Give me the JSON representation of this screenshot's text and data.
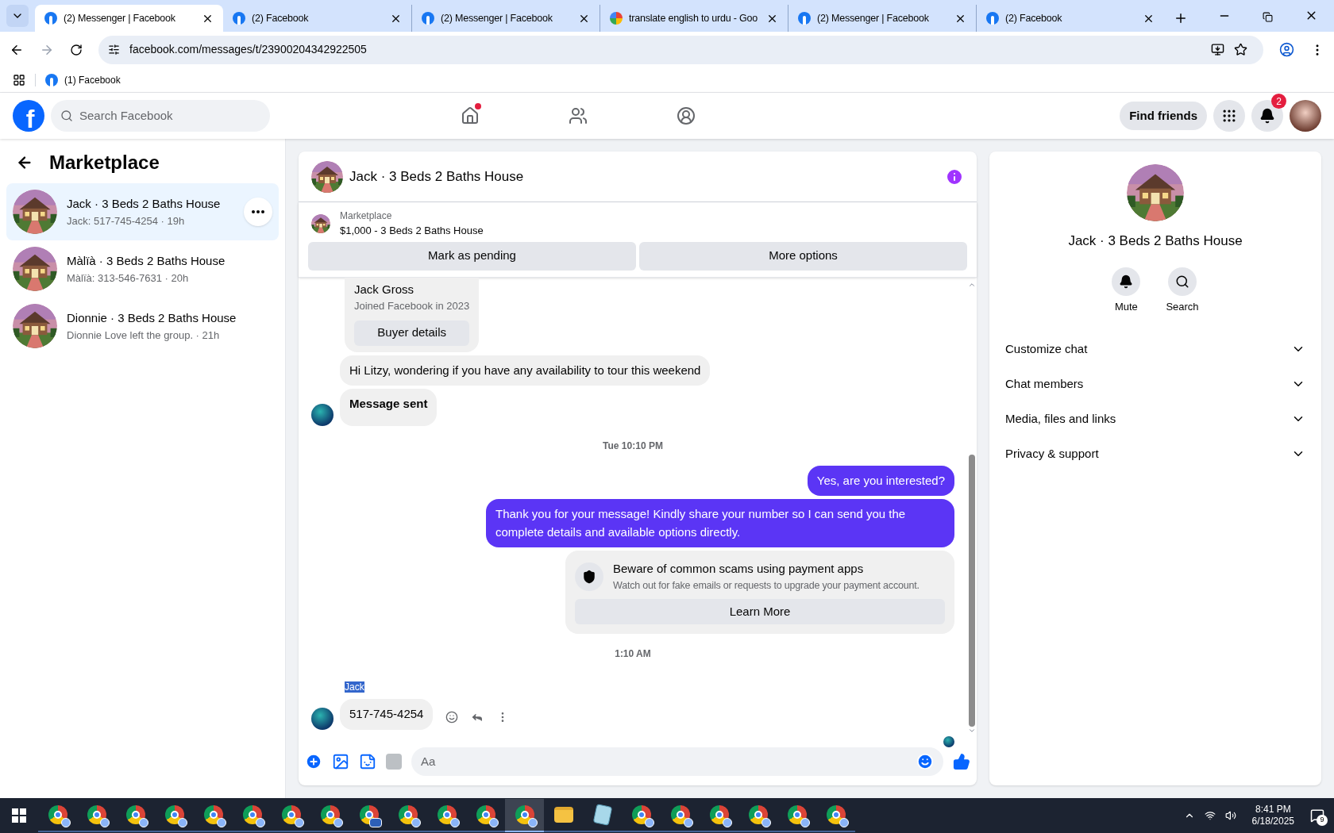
{
  "browser": {
    "tabs": [
      {
        "title": "(2) Messenger | Facebook",
        "kind": "facebook",
        "selected": true
      },
      {
        "title": "(2) Facebook",
        "kind": "facebook",
        "selected": false
      },
      {
        "title": "(2) Messenger | Facebook",
        "kind": "facebook",
        "selected": false
      },
      {
        "title": "translate english to urdu - Goo",
        "kind": "google",
        "selected": false
      },
      {
        "title": "(2) Messenger | Facebook",
        "kind": "facebook",
        "selected": false
      },
      {
        "title": "(2) Facebook",
        "kind": "facebook",
        "selected": false
      }
    ],
    "url": "facebook.com/messages/t/23900204342922505",
    "bookmarks": [
      {
        "label": "(1) Facebook"
      }
    ]
  },
  "header": {
    "logo": "f",
    "search_placeholder": "Search Facebook",
    "nav": [
      {
        "kind": "home",
        "dot": true
      },
      {
        "kind": "friends",
        "dot": false
      },
      {
        "kind": "groups",
        "dot": false
      }
    ],
    "find_friends": "Find friends",
    "notification_count": "2"
  },
  "sidebar": {
    "title": "Marketplace",
    "threads": [
      {
        "title": "Jack · 3 Beds 2 Baths House",
        "preview": "Jack: 517-745-4254 · 19h",
        "selected": true
      },
      {
        "title": "Màlïà · 3 Beds 2 Baths House",
        "preview": "Màlïà: 313-546-7631 · 20h",
        "selected": false
      },
      {
        "title": "Dionnie · 3 Beds 2 Baths House",
        "preview": "Dionnie Love left the group. · 21h",
        "selected": false
      }
    ]
  },
  "chat": {
    "title": "Jack · 3 Beds 2 Baths House",
    "listing": {
      "label": "Marketplace",
      "title": "$1,000 - 3 Beds 2 Baths House"
    },
    "actions": [
      "Mark as pending",
      "More options"
    ],
    "messages": [
      {
        "kind": "profile_card",
        "name": "Jack Gross",
        "subtitle": "Joined Facebook in 2023",
        "button": "Buyer details"
      },
      {
        "kind": "incoming",
        "text": "Hi Litzy, wondering if you have any availability to tour this weekend",
        "avatar": false
      },
      {
        "kind": "incoming_bold",
        "text": "Message sent",
        "avatar": true
      },
      {
        "kind": "timestamp",
        "text": "Tue 10:10 PM"
      },
      {
        "kind": "outgoing",
        "text": "Yes, are you interested?"
      },
      {
        "kind": "outgoing",
        "text": "Thank you for your message! Kindly share your number so I can send you the complete details and available options directly."
      },
      {
        "kind": "warning",
        "title": "Beware of common scams using payment apps",
        "text": "Watch out for fake emails or requests to upgrade your payment account.",
        "button": "Learn More"
      },
      {
        "kind": "timestamp",
        "text": "1:10 AM"
      },
      {
        "kind": "sender",
        "text": "Jack",
        "highlighted": true
      },
      {
        "kind": "incoming",
        "text": "517-745-4254",
        "avatar": true,
        "reactions": true
      }
    ],
    "composer_placeholder": "Aa"
  },
  "details": {
    "title": "Jack · 3 Beds 2 Baths House",
    "actions": [
      {
        "kind": "mute",
        "label": "Mute"
      },
      {
        "kind": "search",
        "label": "Search"
      }
    ],
    "sections": [
      {
        "label": "Customize chat",
        "expanded": false
      },
      {
        "label": "Chat members",
        "expanded": false
      },
      {
        "label": "Media, files and links",
        "expanded": false
      },
      {
        "label": "Privacy & support",
        "expanded": false
      }
    ]
  },
  "taskbar": {
    "apps": [
      {
        "kind": "chrome",
        "selected": false
      },
      {
        "kind": "chrome",
        "selected": false
      },
      {
        "kind": "chrome",
        "selected": false
      },
      {
        "kind": "chrome",
        "selected": false
      },
      {
        "kind": "chrome",
        "selected": false
      },
      {
        "kind": "chrome",
        "selected": false
      },
      {
        "kind": "chrome",
        "selected": false
      },
      {
        "kind": "chrome",
        "selected": false
      },
      {
        "kind": "chrome_card",
        "selected": false
      },
      {
        "kind": "chrome",
        "selected": false
      },
      {
        "kind": "chrome",
        "selected": false
      },
      {
        "kind": "chrome",
        "selected": false
      },
      {
        "kind": "chrome",
        "selected": true
      },
      {
        "kind": "folder",
        "selected": false
      },
      {
        "kind": "notepad",
        "selected": false
      },
      {
        "kind": "chrome",
        "selected": false
      },
      {
        "kind": "chrome",
        "selected": false
      },
      {
        "kind": "chrome",
        "selected": false
      },
      {
        "kind": "chrome",
        "selected": false
      },
      {
        "kind": "chrome",
        "selected": false
      },
      {
        "kind": "chrome",
        "selected": false
      }
    ],
    "time": "8:41 PM",
    "date": "6/18/2025",
    "notification_count": "9"
  }
}
